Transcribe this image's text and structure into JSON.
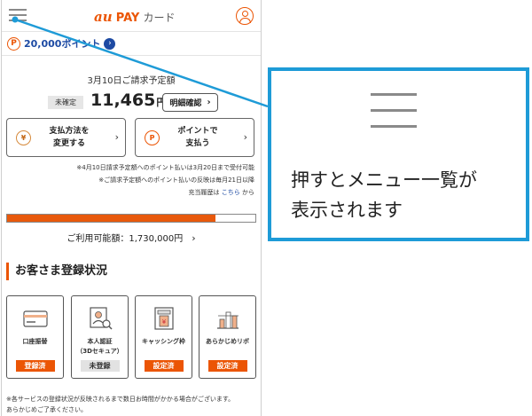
{
  "header": {
    "logo_au": "au",
    "logo_pay": "PAY",
    "logo_card": "カード"
  },
  "points": {
    "badge": "P",
    "value": "20,000ポイント",
    "arrow": "›"
  },
  "billing": {
    "title": "3月10日ご請求予定額",
    "status": "未確定",
    "amount": "11,465",
    "currency": "円",
    "detail_button": "明細確認",
    "chevron": "›"
  },
  "actions": [
    {
      "icon_glyph": "¥",
      "line1": "支払方法を",
      "line2": "変更する"
    },
    {
      "icon_glyph": "P",
      "line1": "ポイントで",
      "line2": "支払う"
    }
  ],
  "notes": {
    "line1": "※4月10日請求予定額へのポイント払いは3月20日まで受付可能",
    "line2": "※ご請求予定額へのポイント払いの反映は毎月21日以降",
    "line3_prefix": "充当履歴は ",
    "line3_link": "こちら",
    "line3_suffix": " から"
  },
  "credit": {
    "used_fraction": 0.84,
    "available_label": "ご利用可能額：1,730,000円"
  },
  "registration": {
    "section_title": "お客さま登録状況",
    "items": [
      {
        "name1": "口座振替",
        "name2": "",
        "status": "登録済",
        "done": true
      },
      {
        "name1": "本人認証",
        "name2": "（3Dセキュア）",
        "status": "未登録",
        "done": false
      },
      {
        "name1": "キャッシング枠",
        "name2": "",
        "status": "設定済",
        "done": true
      },
      {
        "name1": "あらかじめリボ",
        "name2": "",
        "status": "設定済",
        "done": true
      }
    ],
    "footnote_line1": "※各サービスの登録状況が反映されるまで数日お時間がかかる場合がございます。",
    "footnote_line2": "あらかじめご了承ください。"
  },
  "callout": {
    "message_line1": "押すとメニュー一覧が",
    "message_line2": "表示されます",
    "border_color": "#1e9bd7"
  },
  "colors": {
    "accent": "#eb5505",
    "link": "#1d4aa3",
    "callout": "#1e9bd7"
  },
  "icons": {
    "menu": "hamburger-menu-icon",
    "user": "user-account-icon",
    "yen": "yen-coin-icon",
    "point": "point-coin-icon",
    "bank_card": "bank-card-icon",
    "identity": "id-verification-icon",
    "atm": "atm-cash-icon",
    "revolving": "revolving-payment-icon"
  }
}
